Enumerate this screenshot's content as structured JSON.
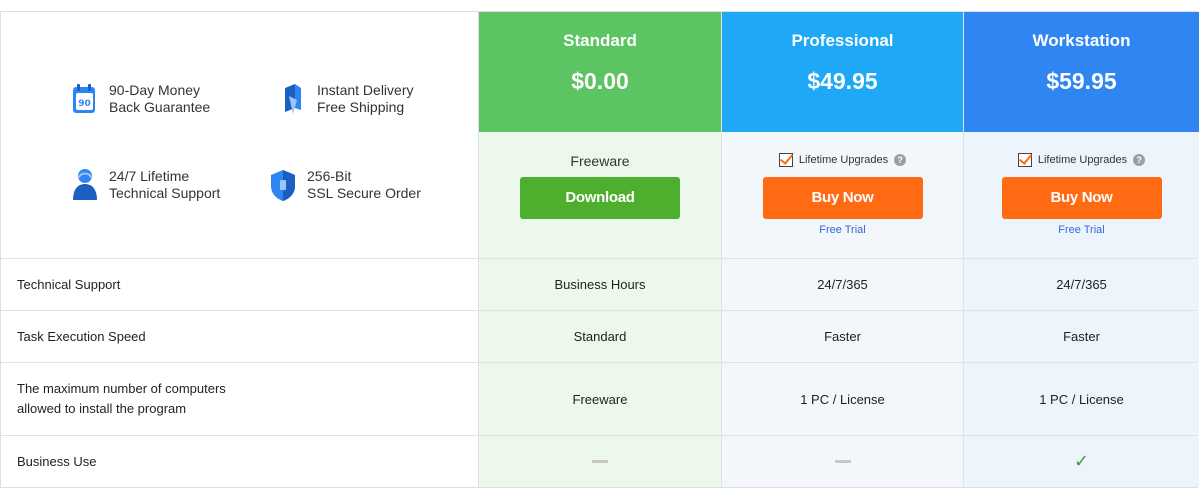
{
  "benefits": [
    {
      "icon": "calendar-90-icon",
      "line1": "90-Day Money",
      "line2": "Back Guarantee",
      "badge": "90"
    },
    {
      "icon": "delivery-icon",
      "line1": "Instant Delivery",
      "line2": "Free Shipping"
    },
    {
      "icon": "support-icon",
      "line1": "24/7 Lifetime",
      "line2": "Technical Support"
    },
    {
      "icon": "shield-icon",
      "line1": "256-Bit",
      "line2": "SSL Secure Order"
    }
  ],
  "plans": [
    {
      "name": "Standard",
      "price": "$0.00",
      "freeware_label": "Freeware",
      "button": "Download"
    },
    {
      "name": "Professional",
      "price": "$49.95",
      "upgrade_label": "Lifetime Upgrades",
      "button": "Buy Now",
      "trial": "Free Trial"
    },
    {
      "name": "Workstation",
      "price": "$59.95",
      "upgrade_label": "Lifetime Upgrades",
      "button": "Buy Now",
      "trial": "Free Trial"
    }
  ],
  "help_glyph": "?",
  "features": [
    {
      "label": "Technical Support",
      "values": [
        "Business Hours",
        "24/7/365",
        "24/7/365"
      ]
    },
    {
      "label": "Task Execution Speed",
      "values": [
        "Standard",
        "Faster",
        "Faster"
      ]
    },
    {
      "label_line1": "The maximum number of computers",
      "label_line2": "allowed to install the program",
      "values": [
        "Freeware",
        "1 PC / License",
        "1 PC / License"
      ]
    },
    {
      "label": "Business Use",
      "values": [
        "none",
        "none",
        "yes"
      ],
      "yes_glyph": "✓"
    }
  ],
  "colors": {
    "standard": "#5dc463",
    "professional": "#1ea8f5",
    "workstation": "#2f86f2",
    "download_button": "#4eaf2f",
    "buy_button": "#ff6a13",
    "check_mark": "#35a13e"
  }
}
